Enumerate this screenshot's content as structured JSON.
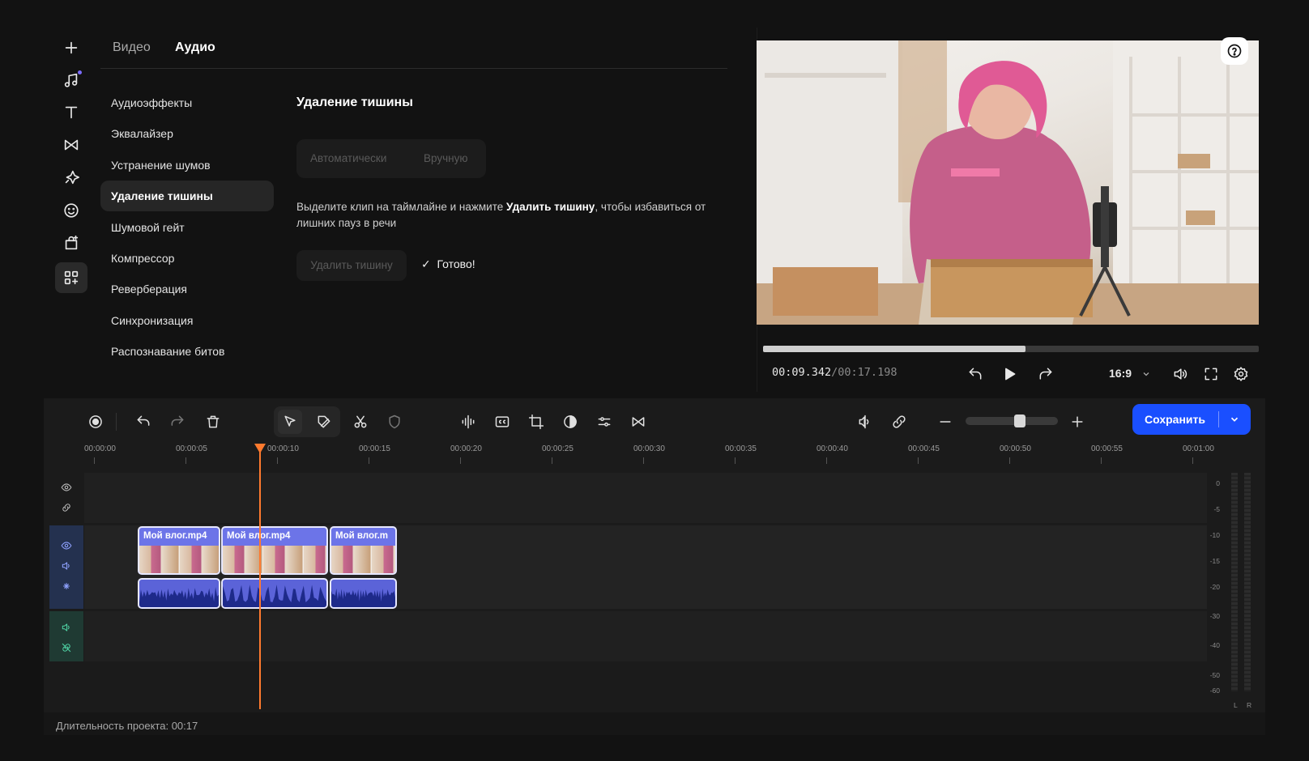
{
  "rail": {
    "icons": [
      "add-icon",
      "music-note-icon",
      "text-icon",
      "transition-icon",
      "effects-icon",
      "sticker-icon",
      "bag-icon",
      "apps-icon"
    ]
  },
  "tabs": [
    {
      "label": "Видео",
      "active": false
    },
    {
      "label": "Аудио",
      "active": true
    }
  ],
  "menu": {
    "items": [
      {
        "label": "Аудиоэффекты",
        "active": false
      },
      {
        "label": "Эквалайзер",
        "active": false
      },
      {
        "label": "Устранение шумов",
        "active": false
      },
      {
        "label": "Удаление тишины",
        "active": true
      },
      {
        "label": "Шумовой гейт",
        "active": false
      },
      {
        "label": "Компрессор",
        "active": false
      },
      {
        "label": "Реверберация",
        "active": false
      },
      {
        "label": "Синхронизация",
        "active": false
      },
      {
        "label": "Распознавание битов",
        "active": false
      }
    ]
  },
  "settings": {
    "title": "Удаление тишины",
    "mode_auto": "Автоматически",
    "mode_manual": "Вручную",
    "desc_before": "Выделите клип на таймлайне и нажмите ",
    "desc_bold": "Удалить тишину",
    "desc_after": ", чтобы избавиться от лишних пауз в речи",
    "remove_button": "Удалить тишину",
    "done_check": "✓",
    "done_label": "Готово!"
  },
  "preview": {
    "current_time": "00:09.342",
    "separator": "/",
    "total_time": "00:17.198",
    "progress_fraction": 0.53,
    "aspect_ratio": "16:9",
    "help_icon": "help-icon"
  },
  "toolbar": {
    "save_label": "Сохранить",
    "zoom_fraction": 0.6,
    "accent_color": "#1a4fff"
  },
  "timeline": {
    "ruler_labels": [
      "00:00:00",
      "00:00:05",
      "00:00:10",
      "00:00:15",
      "00:00:20",
      "00:00:25",
      "00:00:30",
      "00:00:35",
      "00:00:40",
      "00:00:45",
      "00:00:50",
      "00:00:55",
      "00:01:00"
    ],
    "playhead_time": "00:00:09",
    "clips": [
      {
        "name": "Мой влог.mp4"
      },
      {
        "name": "Мой влог.mp4"
      },
      {
        "name": "Мой влог.m"
      }
    ],
    "db_scale": [
      "0",
      "-5",
      "-10",
      "-15",
      "-20",
      "-30",
      "-40",
      "-50",
      "-60"
    ],
    "meter_left": "L",
    "meter_right": "R"
  },
  "footer": {
    "duration_label": "Длительность проекта: 00:17"
  }
}
